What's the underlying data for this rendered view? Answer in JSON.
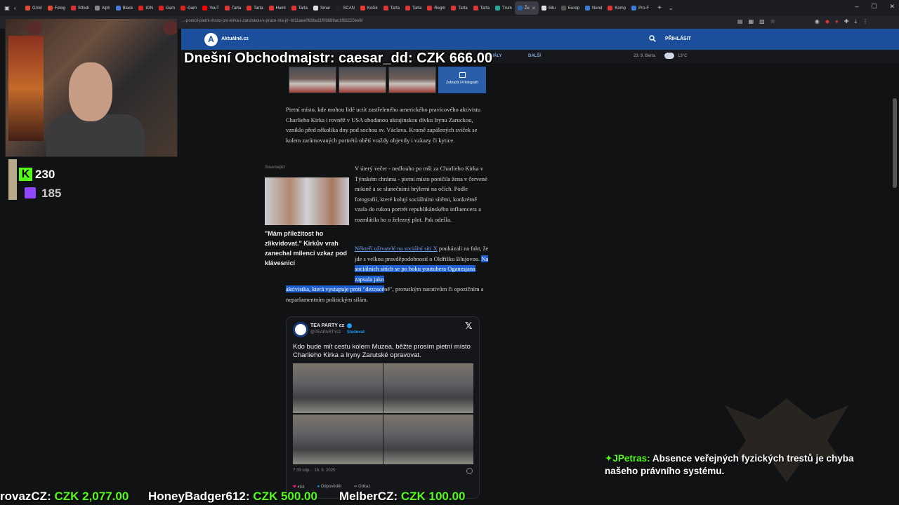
{
  "browser": {
    "tabs": [
      {
        "label": "GAM",
        "color": "#e24a33"
      },
      {
        "label": "Fotog",
        "color": "#e24a33"
      },
      {
        "label": "Středi",
        "color": "#d33"
      },
      {
        "label": "Alph",
        "color": "#888"
      },
      {
        "label": "Black",
        "color": "#4a7bd8"
      },
      {
        "label": "IGN",
        "color": "#d22"
      },
      {
        "label": "Gam",
        "color": "#d22"
      },
      {
        "label": "Gam",
        "color": "#d22"
      },
      {
        "label": "YouT",
        "color": "#f00"
      },
      {
        "label": "Tarta",
        "color": "#d33"
      },
      {
        "label": "Tarta",
        "color": "#d33"
      },
      {
        "label": "Huml",
        "color": "#d33"
      },
      {
        "label": "Tarta",
        "color": "#d33"
      },
      {
        "label": "Smar",
        "color": "#ddd"
      },
      {
        "label": "SCAN",
        "color": "#222"
      },
      {
        "label": "Košik",
        "color": "#e33"
      },
      {
        "label": "Tarta",
        "color": "#d33"
      },
      {
        "label": "Tarta",
        "color": "#d33"
      },
      {
        "label": "Regm",
        "color": "#d33"
      },
      {
        "label": "Tarta",
        "color": "#d33"
      },
      {
        "label": "Tarta",
        "color": "#d33"
      },
      {
        "label": "Trum",
        "color": "#2a9"
      },
      {
        "label": "Že",
        "color": "#2a5ea8",
        "active": true
      },
      {
        "label": "Situ",
        "color": "#ddd"
      },
      {
        "label": "Europ",
        "color": "#555"
      },
      {
        "label": "Nend",
        "color": "#3a7ad8"
      },
      {
        "label": "Komp",
        "color": "#d33"
      },
      {
        "label": "Pro-F",
        "color": "#3a7ad8"
      }
    ],
    "url": "...-ponicil-pietni-misto-pro-kirka-i-zarutskou-v-praze-ma-j/r~bf11aee093ba11f0b689ac1f6b220ee8/"
  },
  "site": {
    "name": "Aktuálně.cz",
    "login": "PŘIHLÁSIT",
    "subnav": [
      "SPECIÁLY",
      "DALŠÍ"
    ],
    "date_name": "23. 9. Berta",
    "temperature": "13°C"
  },
  "article": {
    "gallery_more": "Zobrazit 14 fotografií",
    "p1": "Pietní místo, kde mohou lidé uctít zastřeleného amerického pravicového aktivistu Charlieho Kirka i rovněž v USA ubodanou ukrajinskou dívku Irynu Zaruckou, vzniklo před několika dny pod sochou sv. Václava. Kromě zapálených svíček se kolem zarámovaných portrétů obětí vraždy objevily i vzkazy či kytice.",
    "p2": "V úterý večer - nedlouho po mši za Charlieho Kirka v Týnském chrámu - pietní místo poničila žena v červené mikině a se slunečními brýlemi na očích. Podle fotografií, které kolují sociálními sítěmi, konkrétně vzala do rukou portrét republikánského influencera a rozmlátila ho o železný plot. Pak odešla.",
    "p3_link": "Někteří uživatelé na sociální síti X",
    "p3_a": " poukázali na fakt, že jde s velkou pravděpodobností o Oldřišku Blujovou. ",
    "p3_hl1": "Na sociálních sítích se po boku youtubera Oganesjana zapsala jako",
    "p3_hl2": "aktivistka, která vystupuje proti \"dezoscé",
    "p3_b": "ně\", proruským narativům či opozičním a neparlamentním politickým silám.",
    "related_label": "Související",
    "related_title": "\"Mám příležitost ho zlikvidovat.\" Kirkův vrah zanechal milenci vzkaz pod klávesnicí"
  },
  "tweet": {
    "name": "TEA PARTY cz",
    "handle": "@TEAPARTYcz",
    "follow": "Sledovat",
    "text": "Kdo bude mít cestu kolem Muzea, běžte prosím pietní místo Charlieho Kirka a Iryny Zarutské opravovat.",
    "time": "7:39 odp. · 16. 9. 2025",
    "likes": "453",
    "reply": "Odpovědět",
    "copy": "Odkaz"
  },
  "stream": {
    "kick_viewers": "230",
    "twitch_viewers": "185",
    "top_donor": "Dnešní Obchodmajstr: caesar_dd: CZK 666.00",
    "chat_user": "JPetras:",
    "chat_message": " Absence veřejných fyzických trestů je chyba našeho právního systému.",
    "ticker": [
      {
        "name": "rovazCZ:",
        "value": "CZK 2,077.00"
      },
      {
        "name": "HoneyBadger612:",
        "value": "CZK 500.00"
      },
      {
        "name": "MelberCZ:",
        "value": "CZK 100.00"
      }
    ]
  },
  "colors": {
    "site_blue": "#1b4f9c",
    "kick_green": "#53fc18",
    "twitch_purple": "#9146ff",
    "highlight": "#1e5fd1"
  }
}
